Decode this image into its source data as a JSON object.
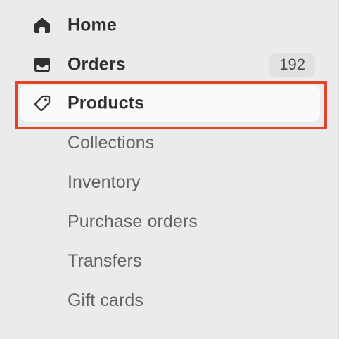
{
  "nav": {
    "home": {
      "label": "Home",
      "icon": "home-icon"
    },
    "orders": {
      "label": "Orders",
      "icon": "inbox-icon",
      "badge": "192"
    },
    "products": {
      "label": "Products",
      "icon": "tag-icon",
      "active": true
    },
    "subitems": [
      {
        "label": "Collections"
      },
      {
        "label": "Inventory"
      },
      {
        "label": "Purchase orders"
      },
      {
        "label": "Transfers"
      },
      {
        "label": "Gift cards"
      }
    ]
  },
  "colors": {
    "background": "#ebebeb",
    "active_item_bg": "#fafafa",
    "highlight_border": "#e0442b",
    "primary_text": "#303030",
    "secondary_text": "#616161",
    "badge_bg": "#e1e1e1"
  }
}
